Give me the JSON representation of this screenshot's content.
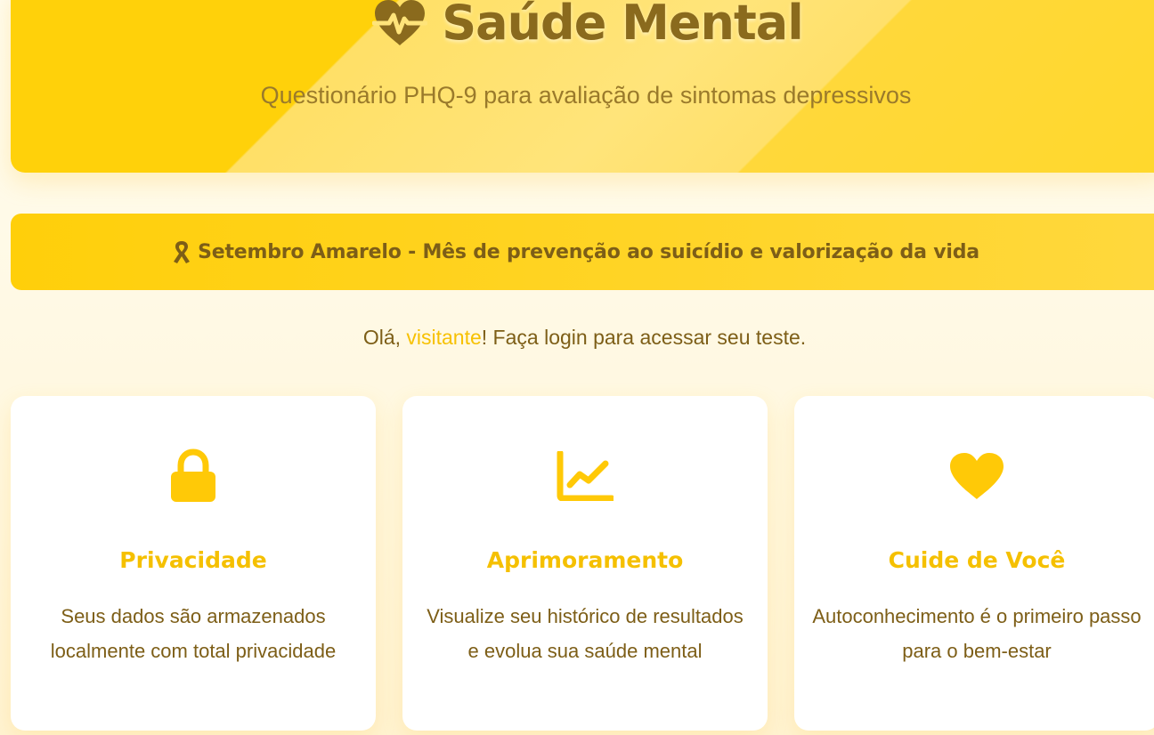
{
  "header": {
    "title": "Saúde Mental",
    "subtitle": "Questionário PHQ-9 para avaliação de sintomas depressivos",
    "icon": "heart-pulse-icon"
  },
  "banner": {
    "icon": "ribbon-icon",
    "text": "Setembro Amarelo - Mês de prevenção ao suicídio e valorização da vida"
  },
  "greeting": {
    "prefix": "Olá, ",
    "user": "visitante",
    "suffix": "! Faça login para acessar seu teste."
  },
  "features": [
    {
      "icon": "lock-icon",
      "title": "Privacidade",
      "text": "Seus dados são armazenados localmente com total privacidade"
    },
    {
      "icon": "chart-line-icon",
      "title": "Aprimoramento",
      "text": "Visualize seu histórico de resultados e evolua sua saúde mental"
    },
    {
      "icon": "heart-icon",
      "title": "Cuide de Você",
      "text": "Autoconhecimento é o primeiro passo para o bem-estar"
    }
  ],
  "colors": {
    "primary": "#ffd10a",
    "accent": "#f5c000",
    "text_dark": "#7d5e17",
    "background": "#fff8e1"
  }
}
